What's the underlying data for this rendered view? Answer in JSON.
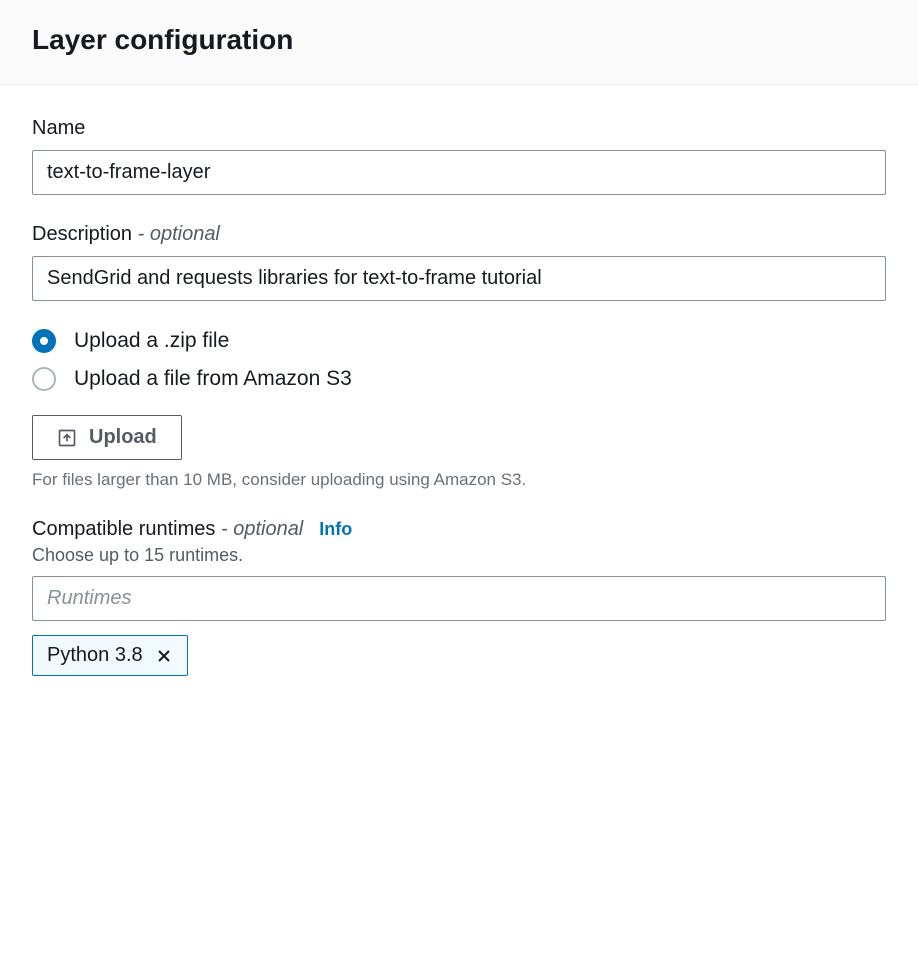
{
  "header": {
    "title": "Layer configuration"
  },
  "name": {
    "label": "Name",
    "value": "text-to-frame-layer"
  },
  "description": {
    "label": "Description",
    "optional_suffix": " - optional",
    "value": "SendGrid and requests libraries for text-to-frame tutorial"
  },
  "upload_source": {
    "options": [
      {
        "label": "Upload a .zip file",
        "selected": true
      },
      {
        "label": "Upload a file from Amazon S3",
        "selected": false
      }
    ]
  },
  "upload": {
    "button_label": "Upload",
    "helper_text": "For files larger than 10 MB, consider uploading using Amazon S3."
  },
  "runtimes": {
    "label": "Compatible runtimes",
    "optional_suffix": " - optional",
    "info_link": "Info",
    "subtext": "Choose up to 15 runtimes.",
    "placeholder": "Runtimes",
    "selected_tags": [
      {
        "label": "Python 3.8"
      }
    ]
  }
}
